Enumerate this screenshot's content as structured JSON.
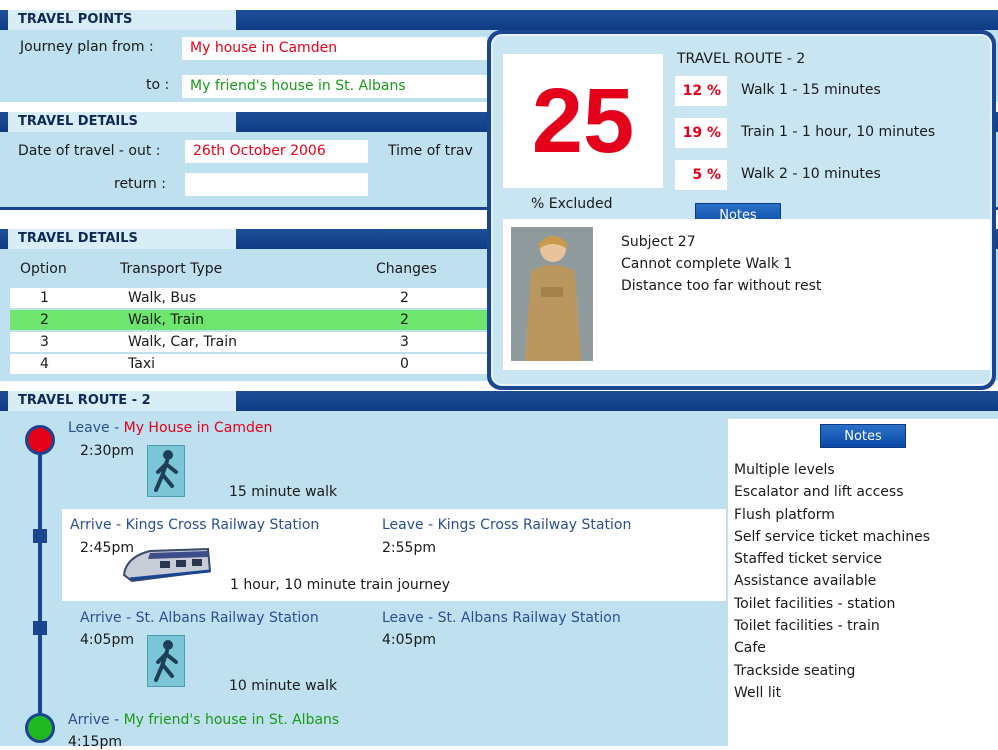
{
  "travel_points": {
    "title": "TRAVEL POINTS",
    "from_label": "Journey plan from :",
    "from_value": "My house in Camden",
    "to_label": "to :",
    "to_value": "My friend's house in St. Albans"
  },
  "travel_details": {
    "title": "TRAVEL DETAILS",
    "date_out_label": "Date of travel - out :",
    "date_out_value": "26th October 2006",
    "time_label": "Time of trav",
    "return_label": "return :",
    "return_value": ""
  },
  "options": {
    "title": "TRAVEL DETAILS",
    "headers": [
      "Option",
      "Transport Type",
      "Changes"
    ],
    "rows": [
      {
        "option": "1",
        "type": "Walk, Bus",
        "changes": "2"
      },
      {
        "option": "2",
        "type": "Walk, Train",
        "changes": "2"
      },
      {
        "option": "3",
        "type": "Walk, Car, Train",
        "changes": "3"
      },
      {
        "option": "4",
        "type": "Taxi",
        "changes": "0"
      }
    ],
    "selected_index": 1
  },
  "result": {
    "excluded_number": "25",
    "excluded_label": "% Excluded",
    "route_title": "TRAVEL ROUTE - 2",
    "legs": [
      {
        "pct": "12 %",
        "desc": "Walk 1 - 15 minutes"
      },
      {
        "pct": "19 %",
        "desc": "Train 1 - 1 hour, 10 minutes"
      },
      {
        "pct": "5 %",
        "desc": "Walk 2 - 10 minutes"
      }
    ],
    "notes_button": "Notes",
    "subject_lines": [
      "Subject 27",
      "Cannot complete Walk 1",
      "Distance too far without rest"
    ]
  },
  "route": {
    "title": "TRAVEL ROUTE  - 2",
    "leave1_prefix": "Leave - ",
    "leave1_place": "My House in Camden",
    "leave1_time": "2:30pm",
    "walk1": "15 minute walk",
    "arrive_kx": "Arrive - Kings Cross Railway Station",
    "arrive_kx_time": "2:45pm",
    "leave_kx": "Leave - Kings Cross Railway Station",
    "leave_kx_time": "2:55pm",
    "train": "1 hour, 10 minute train journey",
    "arrive_sa": "Arrive - St. Albans Railway Station",
    "arrive_sa_time": "4:05pm",
    "leave_sa": "Leave - St. Albans Railway Station",
    "leave_sa_time": "4:05pm",
    "walk2": "10 minute walk",
    "arrive_final_prefix": "Arrive - ",
    "arrive_final_place": "My friend's house in St. Albans",
    "arrive_final_time": "4:15pm"
  },
  "station_notes": {
    "button": "Notes",
    "items": [
      "Multiple levels",
      "Escalator and lift access",
      "Flush platform",
      "Self service ticket machines",
      "Staffed ticket service",
      "Assistance available",
      "Toilet facilities - station",
      "Toilet facilities - train",
      "Cafe",
      "Trackside seating",
      "Well lit"
    ]
  },
  "icons": [
    "walking-person-icon",
    "train-icon",
    "subject-photo",
    "start-dot-icon",
    "end-dot-icon",
    "stop-square-icon"
  ],
  "colors": {
    "header_blue": "#1d4f98",
    "panel_bg": "#bfe0ee",
    "accent_red": "#e4001b",
    "accent_green": "#1a9a1a",
    "selected_row": "#6ee66e"
  }
}
